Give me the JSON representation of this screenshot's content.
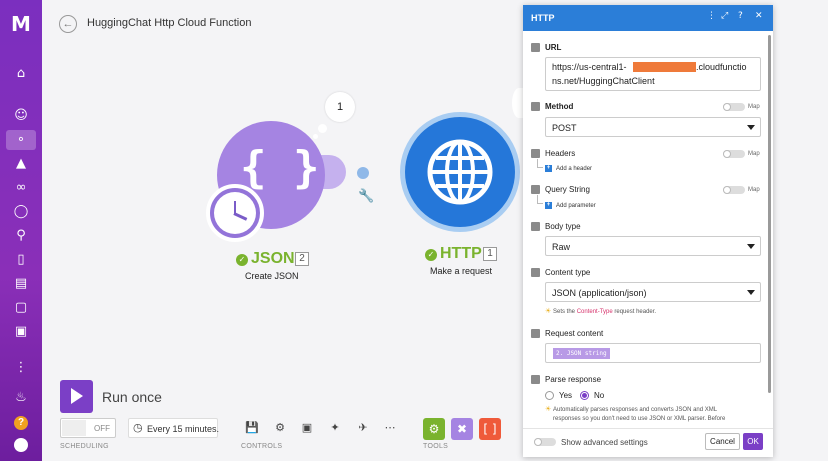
{
  "app": {
    "logo_text": "M",
    "scenario_title": "HuggingChat Http Cloud Function"
  },
  "sidebar": {
    "icons": [
      "home-icon",
      "users-icon",
      "share-icon",
      "puzzle-icon",
      "link-icon",
      "globe-icon",
      "key-icon",
      "phone-icon",
      "database-icon",
      "cube-icon",
      "book-icon",
      "more-icon",
      "bell-icon",
      "help-icon",
      "avatar-icon"
    ],
    "help_label": "?"
  },
  "canvas": {
    "json_module": {
      "name": "JSON",
      "number": "2",
      "subtitle": "Create JSON",
      "glyph": "{ }"
    },
    "http_module": {
      "name": "HTTP",
      "number": "1",
      "subtitle": "Make a request"
    },
    "bubble_count": "1"
  },
  "toolbar": {
    "run_label": "Run once",
    "toggle_label": "OFF",
    "schedule_text": "Every 15 minutes.",
    "labels": {
      "scheduling": "SCHEDULING",
      "controls": "CONTROLS",
      "tools": "TOOLS"
    },
    "tool_colors": [
      "#7ab32e",
      "#a584e2",
      "#ef5a3a"
    ]
  },
  "panel": {
    "title": "HTTP",
    "url": {
      "label": "URL",
      "line1_prefix": "https://us-central1-",
      "line1_suffix": ".cloudfunctio",
      "line2": "ns.net/HuggingChatClient"
    },
    "method": {
      "label": "Method",
      "value": "POST",
      "map": "Map"
    },
    "headers": {
      "label": "Headers",
      "map": "Map",
      "add": "Add a header"
    },
    "query": {
      "label": "Query String",
      "map": "Map",
      "add": "Add parameter"
    },
    "body_type": {
      "label": "Body type",
      "value": "Raw"
    },
    "content_type": {
      "label": "Content type",
      "value": "JSON (application/json)",
      "hint_prefix": "Sets the ",
      "hint_kw": "Content-Type",
      "hint_suffix": " request header."
    },
    "request_content": {
      "label": "Request content",
      "pill": "2. JSON string"
    },
    "parse_response": {
      "label": "Parse response",
      "yes": "Yes",
      "no": "No",
      "hint_line1": "Automatically parses responses and converts JSON and XML",
      "hint_line2": "responses so you don't need to use JSON or XML parser. Before"
    },
    "footer": {
      "advanced": "Show advanced settings",
      "cancel": "Cancel",
      "ok": "OK"
    }
  }
}
